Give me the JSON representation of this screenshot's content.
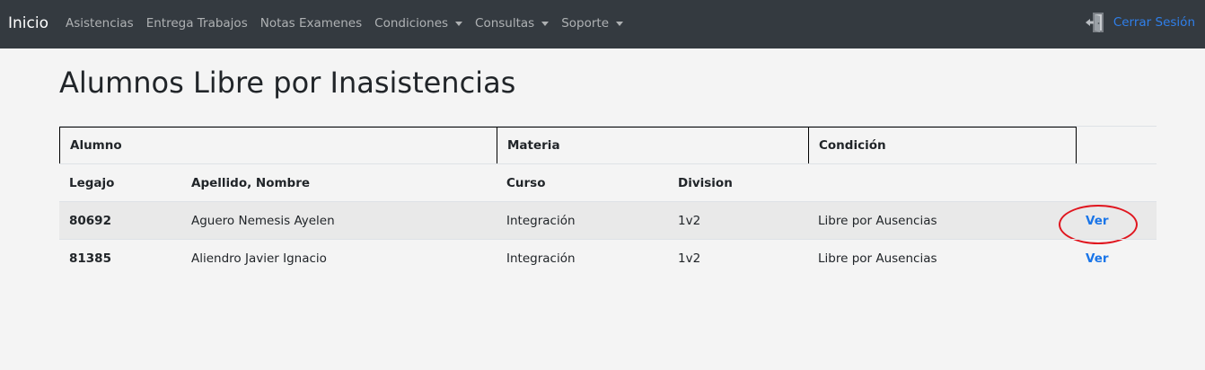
{
  "navbar": {
    "brand": "Inicio",
    "links": [
      {
        "label": "Asistencias",
        "dropdown": false
      },
      {
        "label": "Entrega Trabajos",
        "dropdown": false
      },
      {
        "label": "Notas Examenes",
        "dropdown": false
      },
      {
        "label": "Condiciones",
        "dropdown": true
      },
      {
        "label": "Consultas",
        "dropdown": true
      },
      {
        "label": "Soporte",
        "dropdown": true
      }
    ],
    "logout_label": "Cerrar Sesión",
    "logout_icon": "door-exit-icon"
  },
  "page": {
    "title": "Alumnos Libre por Inasistencias"
  },
  "table": {
    "group_headers": [
      "Alumno",
      "Materia",
      "Condición"
    ],
    "columns": [
      "Legajo",
      "Apellido, Nombre",
      "Curso",
      "Division"
    ],
    "rows": [
      {
        "legajo": "80692",
        "nombre": "Aguero Nemesis Ayelen",
        "curso": "Integración",
        "division": "1v2",
        "condicion": "Libre por Ausencias",
        "action": "Ver"
      },
      {
        "legajo": "81385",
        "nombre": "Aliendro Javier Ignacio",
        "curso": "Integración",
        "division": "1v2",
        "condicion": "Libre por Ausencias",
        "action": "Ver"
      }
    ]
  },
  "colors": {
    "navbar_bg": "#343a40",
    "link_blue": "#1a75e8",
    "highlight_ring": "#e0161f"
  }
}
